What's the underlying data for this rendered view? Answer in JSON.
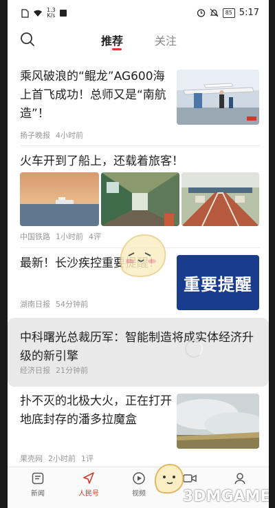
{
  "status": {
    "speed_value": "1.3",
    "speed_unit": "K/s",
    "battery": "85",
    "time": "5:17"
  },
  "nav": {
    "tab_recommend": "推荐",
    "tab_follow": "关注"
  },
  "feed": [
    {
      "title": "乘风破浪的“鲲龙”AG600海上首飞成功！总师又是“南航造”！",
      "source": "扬子晚报",
      "time": "4小时前",
      "comments": ""
    },
    {
      "title": "火车开到了船上，还载着旅客！",
      "source": "中国铁路",
      "time": "1小时前",
      "comments": "4评"
    },
    {
      "title": "最新！长沙疾控重要提醒！",
      "source": "湖南日报",
      "time": "54分钟前",
      "comments": "",
      "thumb_text": "重要提醒"
    },
    {
      "title": "中科曙光总裁历军：智能制造将成实体经济升级的新引擎",
      "source": "经济日报",
      "time": "21分钟前",
      "comments": ""
    },
    {
      "title": "扑不灭的北极大火，正在打开地底封存的潘多拉魔盒",
      "source": "果壳网",
      "time": "2小时前",
      "comments": "1评"
    }
  ],
  "bottom_nav": {
    "news": "新闻",
    "people": "人民号",
    "video": "视频",
    "live": "",
    "me": ""
  },
  "watermark": "3DMGAME",
  "colors": {
    "accent": "#d0392c",
    "thumb_alert_bg": "#1a3c8f"
  }
}
